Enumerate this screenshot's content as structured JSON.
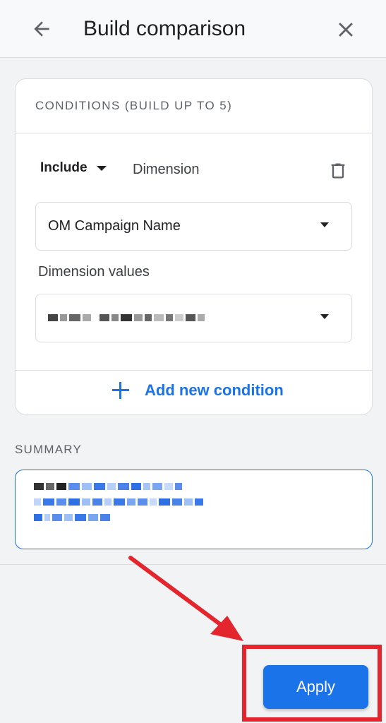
{
  "header": {
    "title": "Build comparison",
    "back_icon": "arrow-back-icon",
    "close_icon": "close-icon"
  },
  "conditions": {
    "heading": "CONDITIONS (BUILD UP TO 5)",
    "include_label": "Include",
    "dimension_label": "Dimension",
    "delete_icon": "trash-icon",
    "dimension_select_value": "OM Campaign Name",
    "dimension_values_label": "Dimension values",
    "add_condition_label": "Add new condition"
  },
  "summary": {
    "label": "SUMMARY"
  },
  "footer": {
    "apply_label": "Apply"
  },
  "annotation": {
    "color": "#e3262d"
  },
  "colors": {
    "accent": "#1a73e8",
    "background": "#f1f3f4"
  }
}
